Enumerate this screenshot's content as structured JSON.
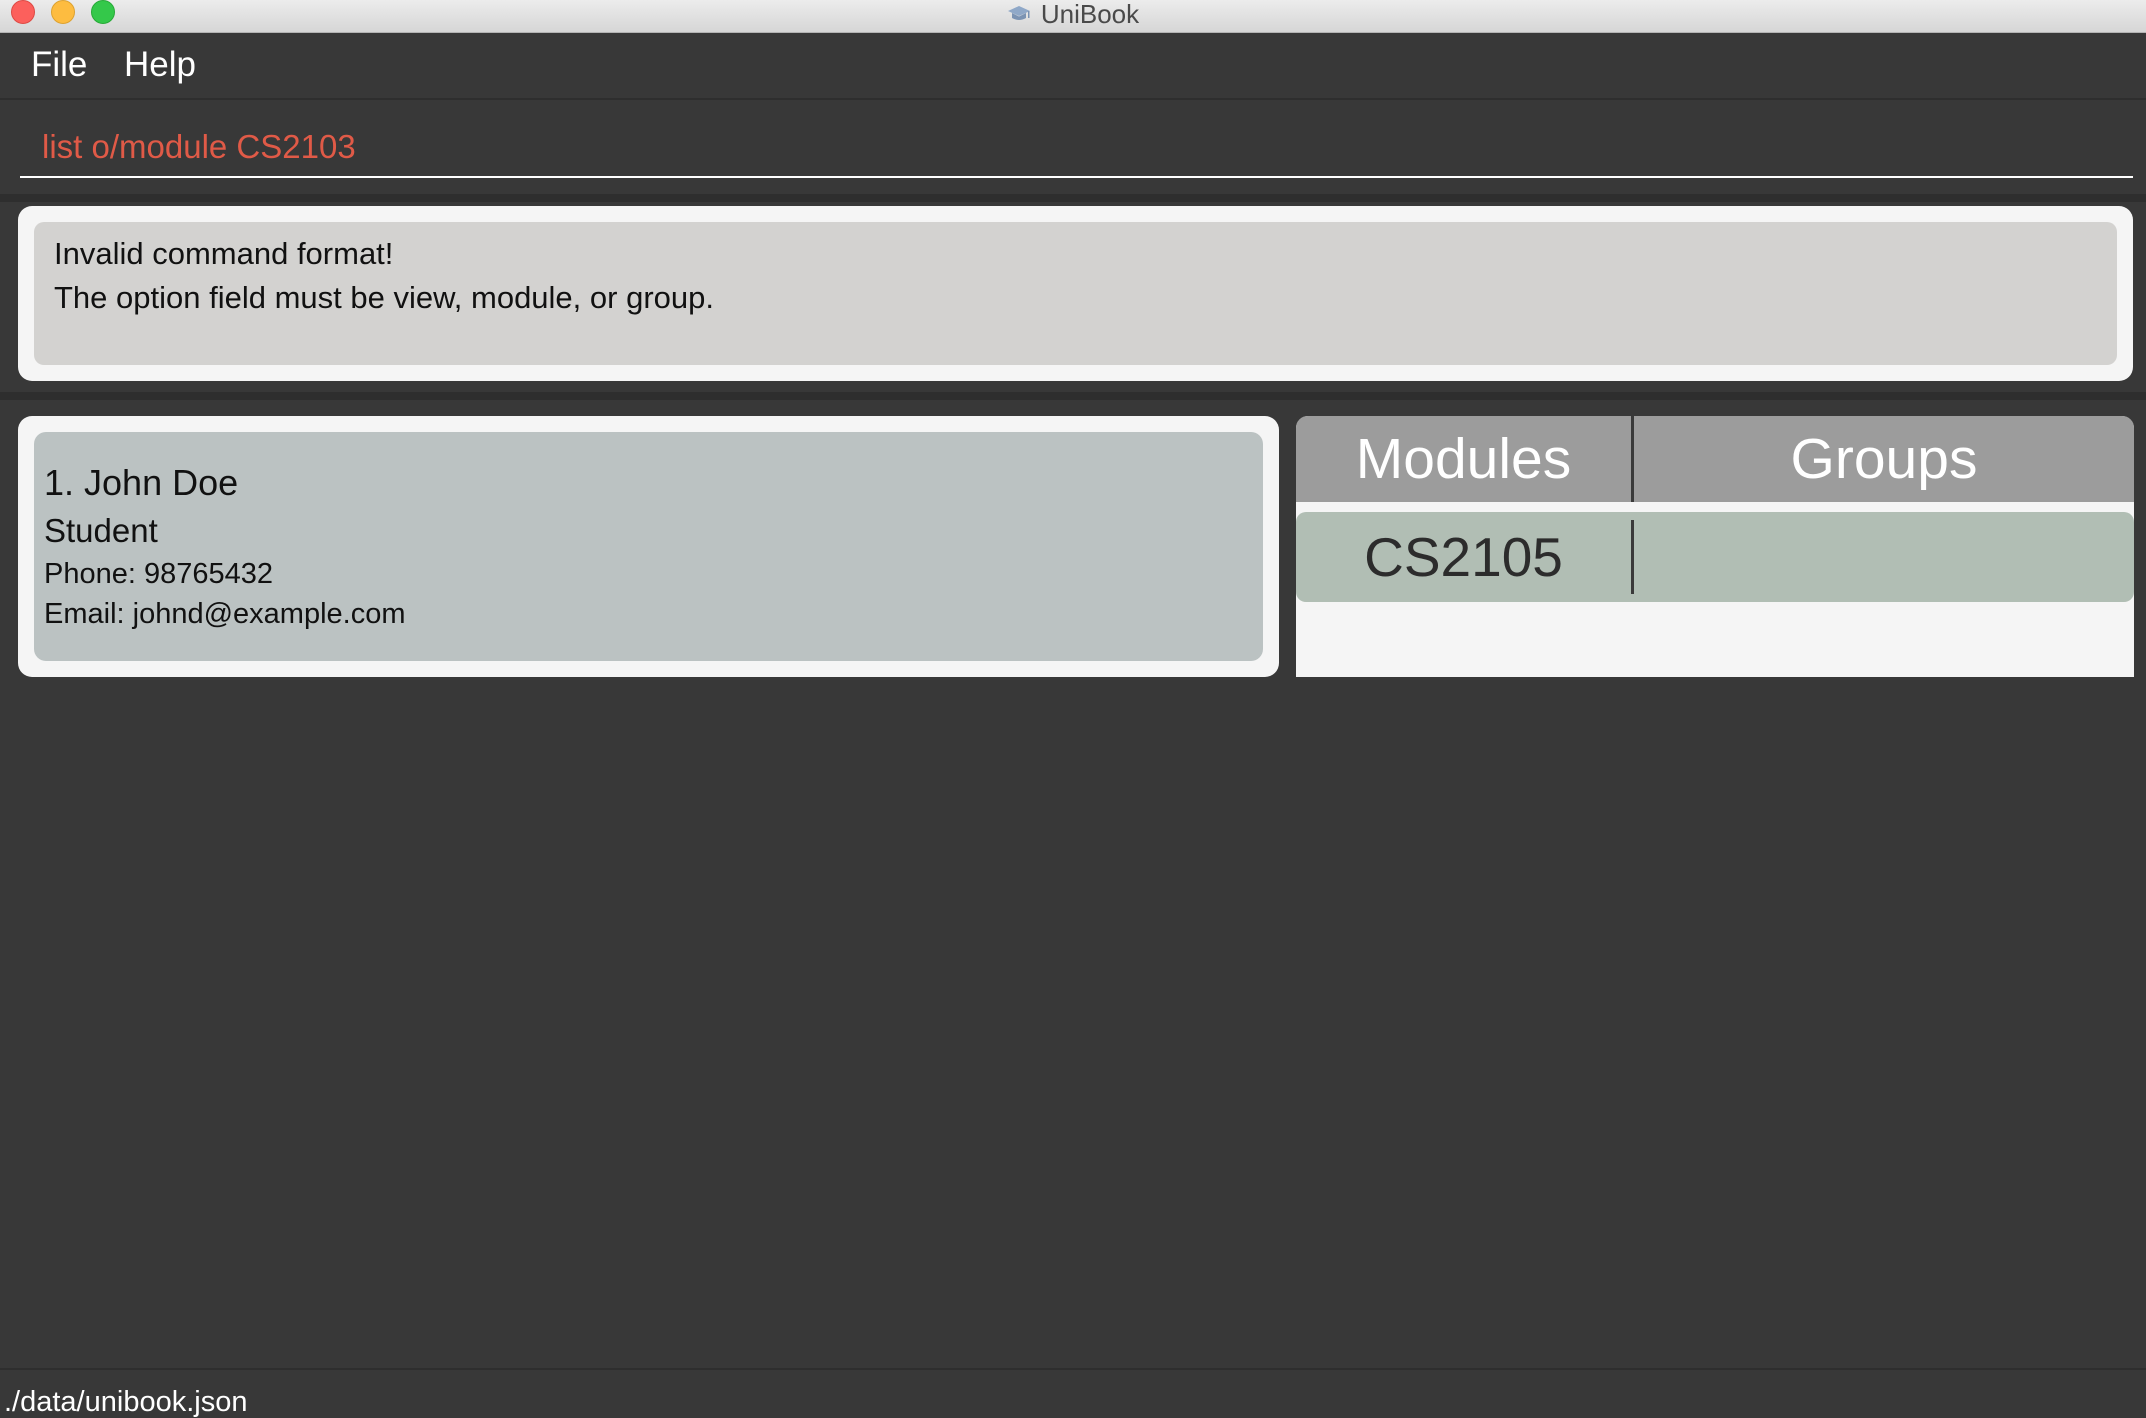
{
  "window": {
    "title": "UniBook",
    "title_icon": "graduation-cap-icon"
  },
  "menu": {
    "items": [
      {
        "label": "File"
      },
      {
        "label": "Help"
      }
    ]
  },
  "command": {
    "value": "list o/module CS2103",
    "color": "#e05a47"
  },
  "result": {
    "lines": [
      "Invalid command format!",
      "The option field must be view, module, or group."
    ]
  },
  "person_list": [
    {
      "index_name": "1.  John Doe",
      "role": "Student",
      "phone": "Phone: 98765432",
      "email": "Email: johnd@example.com"
    }
  ],
  "module_table": {
    "headers": [
      "Modules",
      "Groups"
    ],
    "rows": [
      {
        "module": "CS2105",
        "groups": ""
      }
    ]
  },
  "status_bar": {
    "path": "./data/unibook.json"
  }
}
